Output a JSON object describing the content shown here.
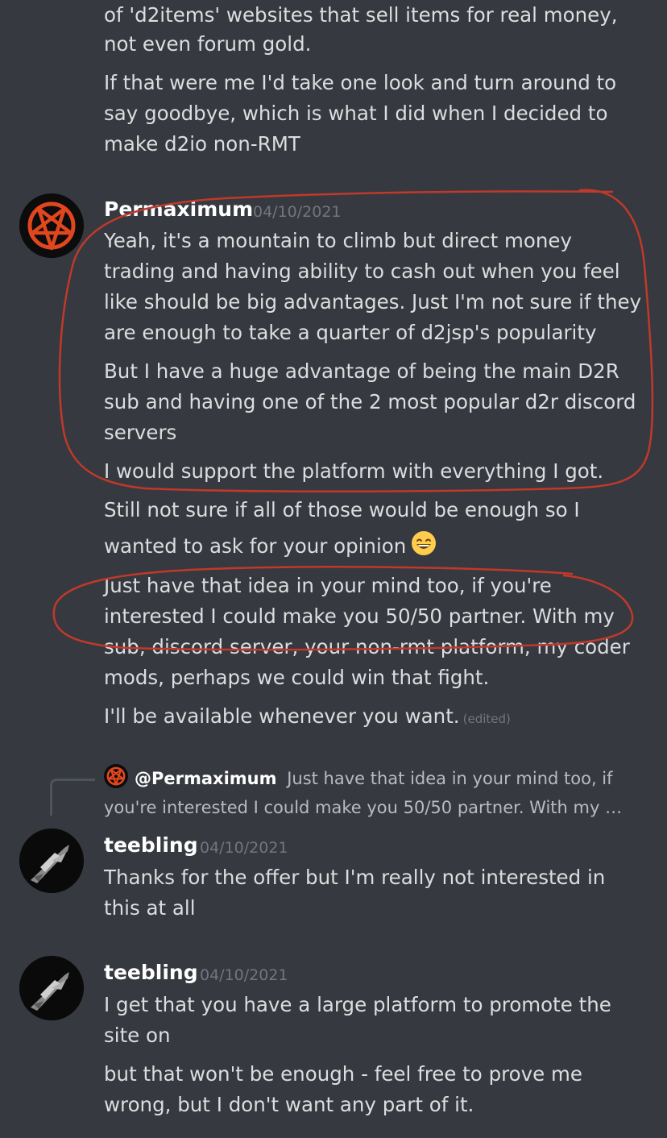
{
  "messages_top": {
    "lines": [
      "of 'd2items' websites that sell items for real money,",
      "not even forum gold.",
      "If that were me I'd take one look and turn around to",
      "say goodbye, which is what I did when I decided to",
      "make d2io non-RMT"
    ]
  },
  "message_permaximum": {
    "author": "Permaximum",
    "timestamp": "04/10/2021",
    "avatar_icon": "pentagram-icon",
    "lines": [
      "Yeah, it's a mountain to climb but direct money",
      "trading and having ability to cash out when you feel",
      "like should be big advantages. Just I'm not sure if they",
      "are enough to  take a quarter of d2jsp's popularity",
      "But I have a huge advantage of being the main D2R",
      "sub and having one of the 2 most popular d2r discord",
      "servers",
      "I would support the platform with everything I got.",
      "Still not sure if all of those would be enough so I",
      "wanted to ask for your opinion",
      "Just have that idea in your mind too, if you're",
      "interested I could make you 50/50 partner. With my",
      "sub, discord server, your non-rmt platform, my coder",
      "mods, perhaps we could win that fight.",
      "I'll be available whenever you want."
    ],
    "emoji": "grinning-face-emoji",
    "edited_label": "(edited)"
  },
  "reply_preview": {
    "mention": "@Permaximum",
    "line1": "Just have that idea in your mind too, if",
    "line2": "you're interested I could make you 50/50 partner. With my …"
  },
  "message_teebling_1": {
    "author": "teebling",
    "timestamp": "04/10/2021",
    "avatar_icon": "spaceship-icon",
    "lines": [
      "Thanks for the offer but I'm really not interested in",
      "this at all"
    ]
  },
  "message_teebling_2": {
    "author": "teebling",
    "timestamp": "04/10/2021",
    "avatar_icon": "spaceship-icon",
    "lines": [
      "I get that you have a large platform to promote the",
      "site on",
      "but that won't be enough - feel free to prove me",
      "wrong, but I don't want any part of it."
    ]
  },
  "colors": {
    "background": "#36393f",
    "text": "#dcddde",
    "muted": "#72767d",
    "annotation_red": "#c0392b"
  }
}
